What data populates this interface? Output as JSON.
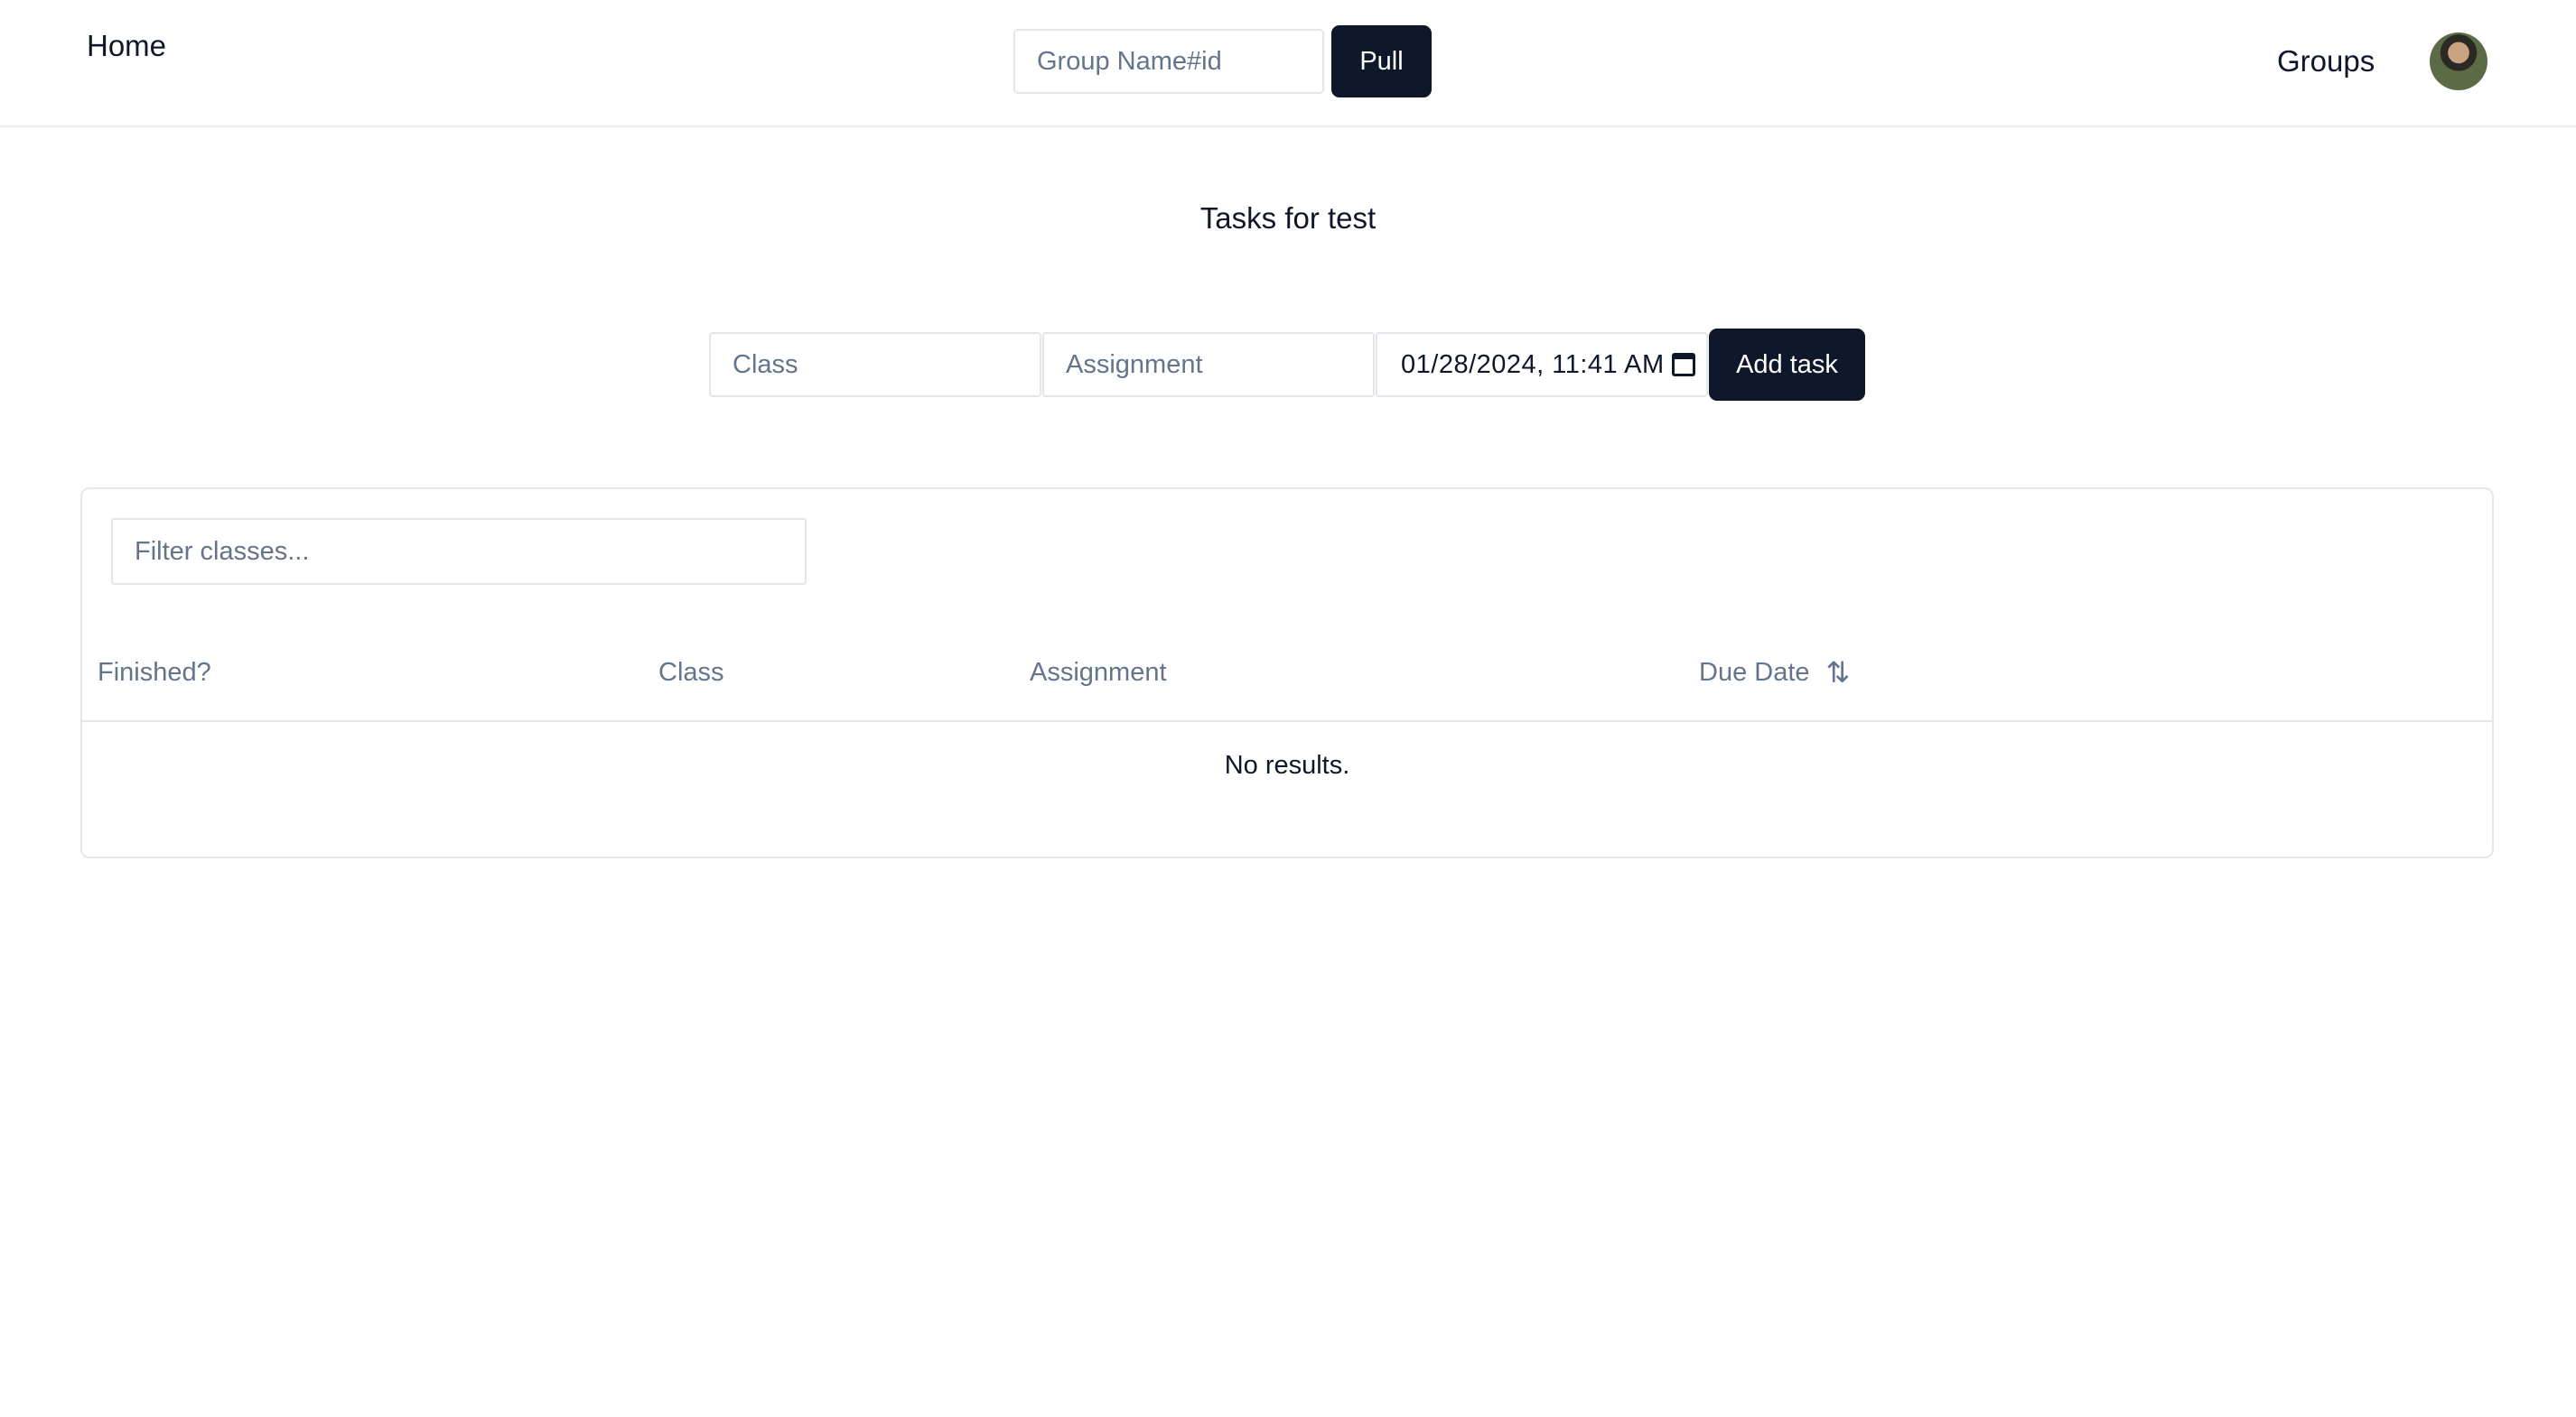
{
  "header": {
    "home_label": "Home",
    "group_input_placeholder": "Group Name#id",
    "pull_label": "Pull",
    "groups_label": "Groups"
  },
  "page": {
    "title": "Tasks for test"
  },
  "form": {
    "class_placeholder": "Class",
    "assignment_placeholder": "Assignment",
    "due_date_value": "01/28/2024, 11:41 AM",
    "add_task_label": "Add task"
  },
  "table": {
    "filter_placeholder": "Filter classes...",
    "columns": [
      "Finished?",
      "Class",
      "Assignment",
      "Due Date"
    ],
    "sort_icon": "⇅",
    "empty_message": "No results."
  },
  "icons": {
    "avatar": "user-avatar",
    "calendar": "calendar-icon",
    "sort": "sort-icon"
  },
  "colors": {
    "primary": "#0f172a",
    "muted": "#64748b",
    "border": "#e2e5ea"
  }
}
